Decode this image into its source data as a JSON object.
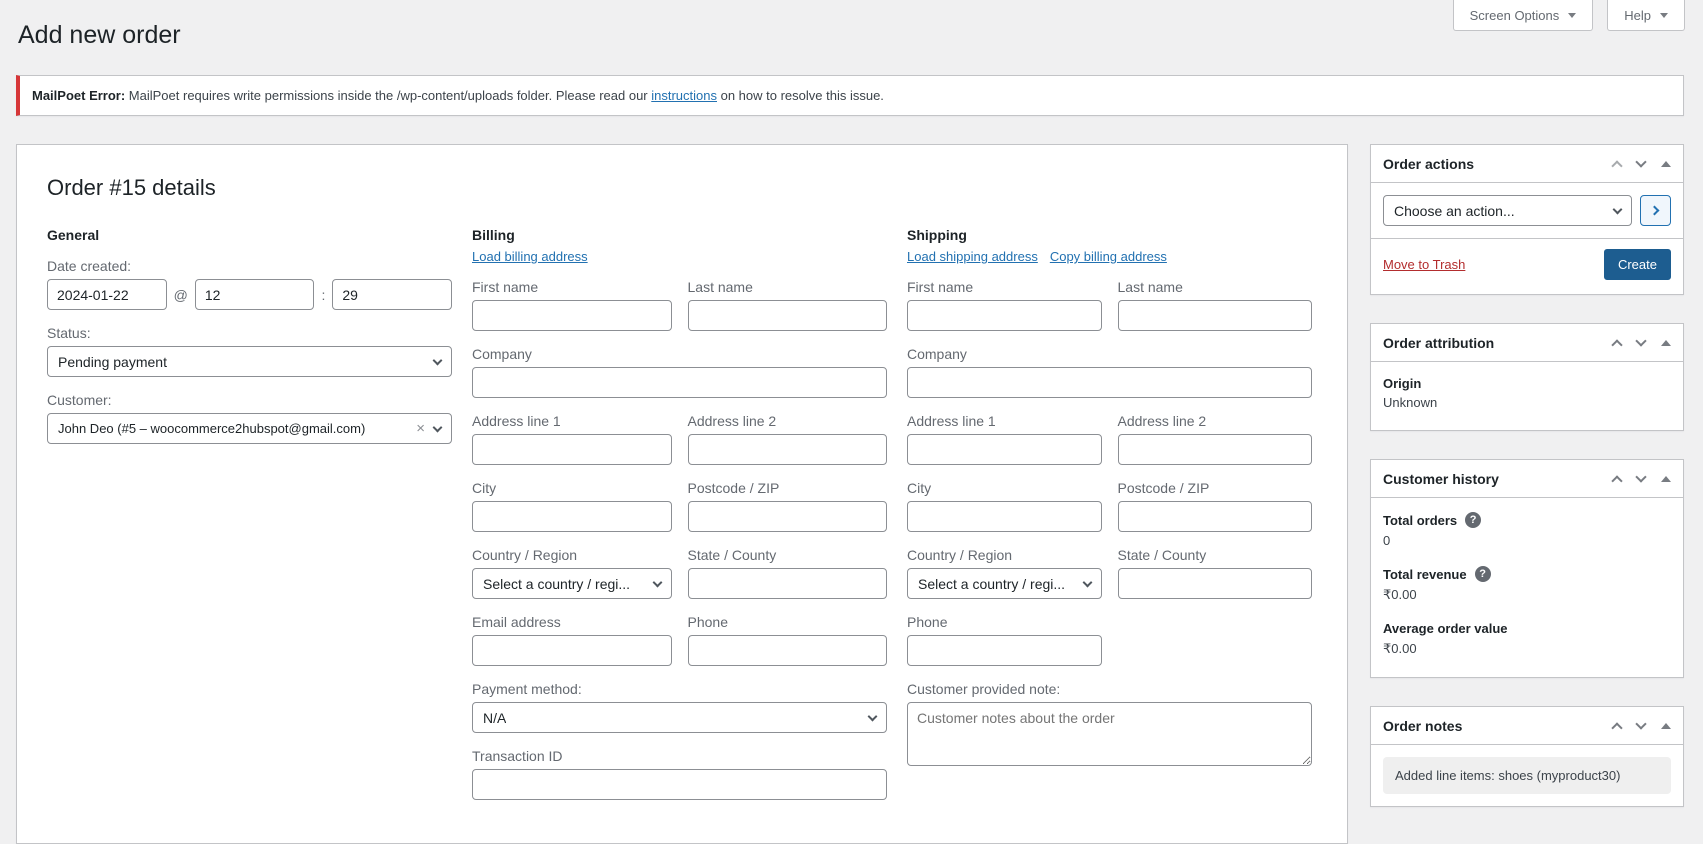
{
  "theme": {
    "colors": {
      "background": "#f0f0f1",
      "panel": "#ffffff",
      "border": "#c3c4c7",
      "input_border": "#8c8f94",
      "heading": "#1d2327",
      "text": "#3c434a",
      "muted": "#646970",
      "link": "#2271b1",
      "danger": "#b32d2e",
      "error": "#d63638",
      "button_primary": "#1d5d90",
      "button_secondary_bg": "#f0f6fc",
      "icon": "#787c82",
      "note_bg": "#efefef"
    }
  },
  "toolbar": {
    "screen_options_label": "Screen Options",
    "help_label": "Help"
  },
  "page": {
    "title": "Add new order"
  },
  "notice": {
    "prefix": "MailPoet Error:",
    "body": " MailPoet requires write permissions inside the /wp-content/uploads folder. Please read our ",
    "link_label": "instructions",
    "suffix": " on how to resolve this issue."
  },
  "order_details": {
    "title": "Order #15 details",
    "general": {
      "heading": "General",
      "date_created_label": "Date created:",
      "date_value": "2024-01-22",
      "at_symbol": "@",
      "hour_value": "12",
      "time_separator": ":",
      "minute_value": "29",
      "status_label": "Status:",
      "status_value": "Pending payment",
      "customer_label": "Customer:",
      "customer_value": "John Deo (#5 – woocommerce2hubspot@gmail.com)",
      "clear_symbol": "×"
    },
    "billing": {
      "heading": "Billing",
      "load_link_label": "Load billing address",
      "first_name_label": "First name",
      "last_name_label": "Last name",
      "company_label": "Company",
      "address1_label": "Address line 1",
      "address2_label": "Address line 2",
      "city_label": "City",
      "postcode_label": "Postcode / ZIP",
      "country_label": "Country / Region",
      "country_value": "Select a country / regi...",
      "state_label": "State / County",
      "email_label": "Email address",
      "phone_label": "Phone",
      "payment_method_label": "Payment method:",
      "payment_method_value": "N/A",
      "transaction_id_label": "Transaction ID"
    },
    "shipping": {
      "heading": "Shipping",
      "load_link_label": "Load shipping address",
      "copy_link_label": "Copy billing address",
      "first_name_label": "First name",
      "last_name_label": "Last name",
      "company_label": "Company",
      "address1_label": "Address line 1",
      "address2_label": "Address line 2",
      "city_label": "City",
      "postcode_label": "Postcode / ZIP",
      "country_label": "Country / Region",
      "country_value": "Select a country / regi...",
      "state_label": "State / County",
      "phone_label": "Phone",
      "note_label": "Customer provided note:",
      "note_placeholder": "Customer notes about the order"
    }
  },
  "sidebar": {
    "order_actions": {
      "title": "Order actions",
      "action_value": "Choose an action...",
      "trash_label": "Move to Trash",
      "create_label": "Create"
    },
    "order_attribution": {
      "title": "Order attribution",
      "origin_label": "Origin",
      "origin_value": "Unknown"
    },
    "customer_history": {
      "title": "Customer history",
      "rows": [
        {
          "label": "Total orders",
          "value": "0",
          "help": "?"
        },
        {
          "label": "Total revenue",
          "value": "₹0.00",
          "help": "?"
        },
        {
          "label": "Average order value",
          "value": "₹0.00"
        }
      ]
    },
    "order_notes": {
      "title": "Order notes",
      "notes": [
        "Added line items: shoes (myproduct30)"
      ]
    }
  }
}
